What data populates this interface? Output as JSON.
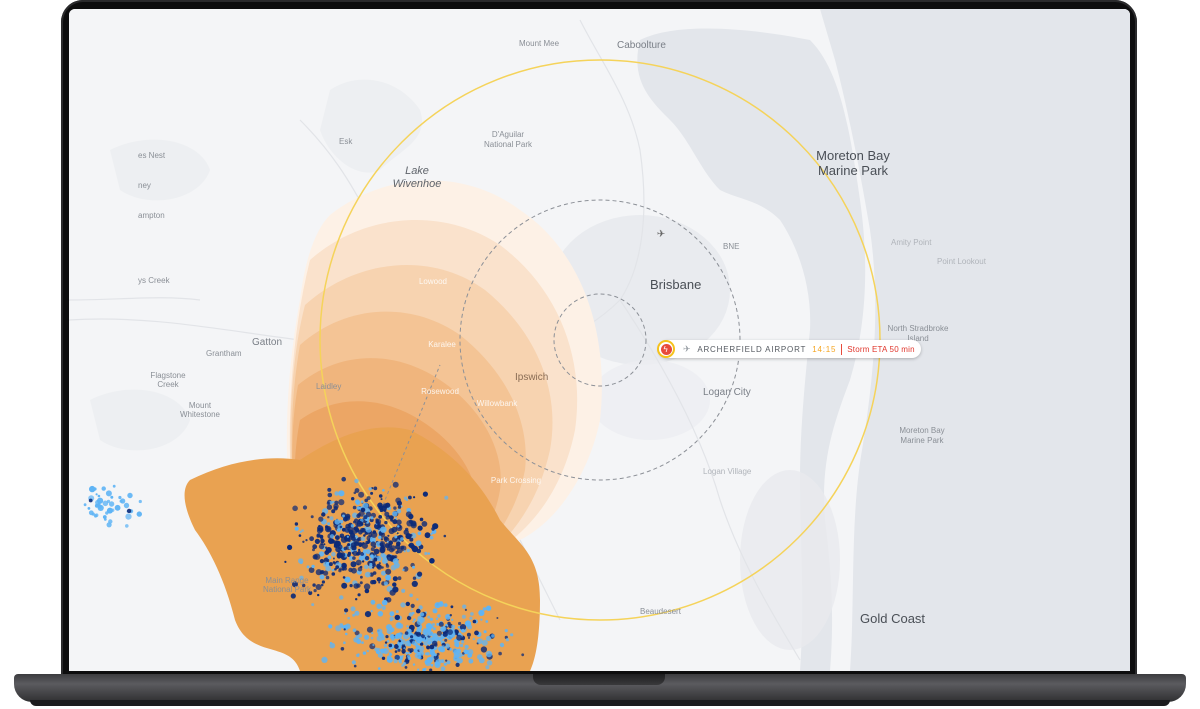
{
  "map": {
    "places": {
      "caboolture": "Caboolture",
      "mount_mee": "Mount Mee",
      "esk": "Esk",
      "daguilar": "D'Aguilar\nNational Park",
      "daguilar_line1": "D'Aguilar",
      "daguilar_line2": "National Park",
      "lake_wivenhoe_1": "Lake",
      "lake_wivenhoe_2": "Wivenhoe",
      "moreton_bay_1": "Moreton Bay",
      "moreton_bay_2": "Marine Park",
      "moreton_bay_small_1": "Moreton Bay",
      "moreton_bay_small_2": "Marine Park",
      "brisbane": "Brisbane",
      "bne": "BNE",
      "ipswich": "Ipswich",
      "logan_city": "Logan City",
      "logan_village": "Logan Village",
      "gatton": "Gatton",
      "grantham": "Grantham",
      "flagstone_1": "Flagstone",
      "flagstone_2": "Creek",
      "mount_whitestone_1": "Mount",
      "mount_whitestone_2": "Whitestone",
      "laidley": "Laidley",
      "main_range_1": "Main Range",
      "main_range_2": "National Park",
      "beaudesert": "Beaudesert",
      "gold_coast": "Gold Coast",
      "amity_point": "Amity Point",
      "point_lookout": "Point Lookout",
      "north_stradbroke_1": "North Stradbroke",
      "north_stradbroke_2": "Island",
      "ys_creek": "ys Creek",
      "es_nest": "es Nest",
      "ampton": "ampton",
      "ney": "ney"
    },
    "zones": {
      "lowood": "Lowood",
      "karalee": "Karalee",
      "rosewood": "Rosewood",
      "willowbank": "Willowbank",
      "park_crossing": "Park Crossing"
    },
    "callout": {
      "airport_name": "ARCHERFIELD AIRPORT",
      "time": "14:15",
      "eta": "Storm ETA 50 min"
    },
    "colors": {
      "storm_core": "#e9a251",
      "storm_fade": "#fbeadb",
      "radius_ring": "#f5d35a",
      "lightning_dark": "#0c2a78",
      "lightning_light": "#5fb4f5",
      "alert_red": "#e0352b"
    },
    "icons": {
      "airport": "plane-icon",
      "storm": "lightning-icon"
    }
  }
}
